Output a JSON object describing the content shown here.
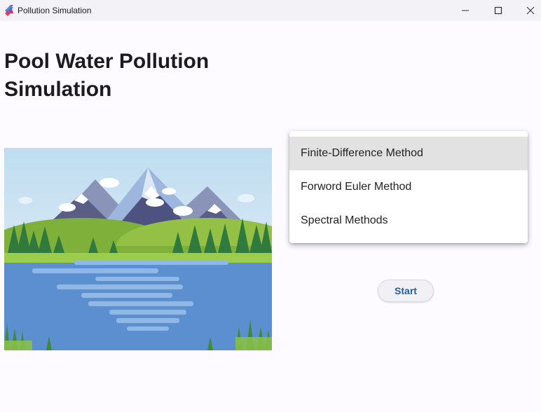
{
  "window": {
    "title": "Pollution Simulation"
  },
  "page": {
    "title": "Pool Water Pollution Simulation"
  },
  "illustration": {
    "icon": "mountain-lake-illustration"
  },
  "method_menu": {
    "items": [
      {
        "label": "Finite-Difference Method",
        "selected": true
      },
      {
        "label": "Forword Euler Method",
        "selected": false
      },
      {
        "label": "Spectral Methods",
        "selected": false
      }
    ]
  },
  "start_button": {
    "label": "Start"
  },
  "colors": {
    "accent": "#1f5f9e",
    "menu_highlight": "#e2e2e2",
    "background": "#fdfbff"
  }
}
